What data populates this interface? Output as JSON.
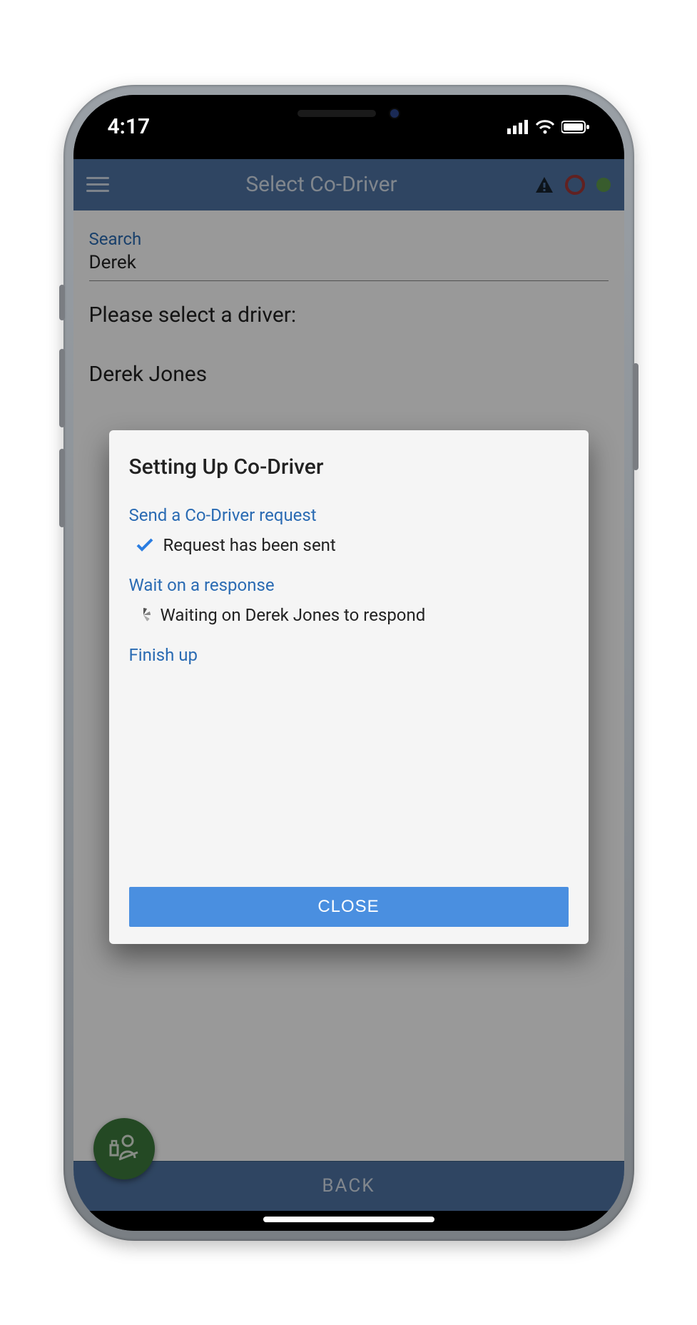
{
  "statusbar": {
    "time": "4:17"
  },
  "header": {
    "title": "Select Co-Driver"
  },
  "search": {
    "label": "Search",
    "value": "Derek"
  },
  "prompt": "Please select a driver:",
  "driver_list": {
    "item0": "Derek Jones"
  },
  "modal": {
    "title": "Setting Up Co-Driver",
    "step1_head": "Send a Co-Driver request",
    "step1_body": "Request has been sent",
    "step2_head": "Wait on a response",
    "step2_body": "Waiting on Derek Jones to respond",
    "step3_head": "Finish up",
    "close_label": "CLOSE"
  },
  "bottom": {
    "back_label": "BACK"
  }
}
